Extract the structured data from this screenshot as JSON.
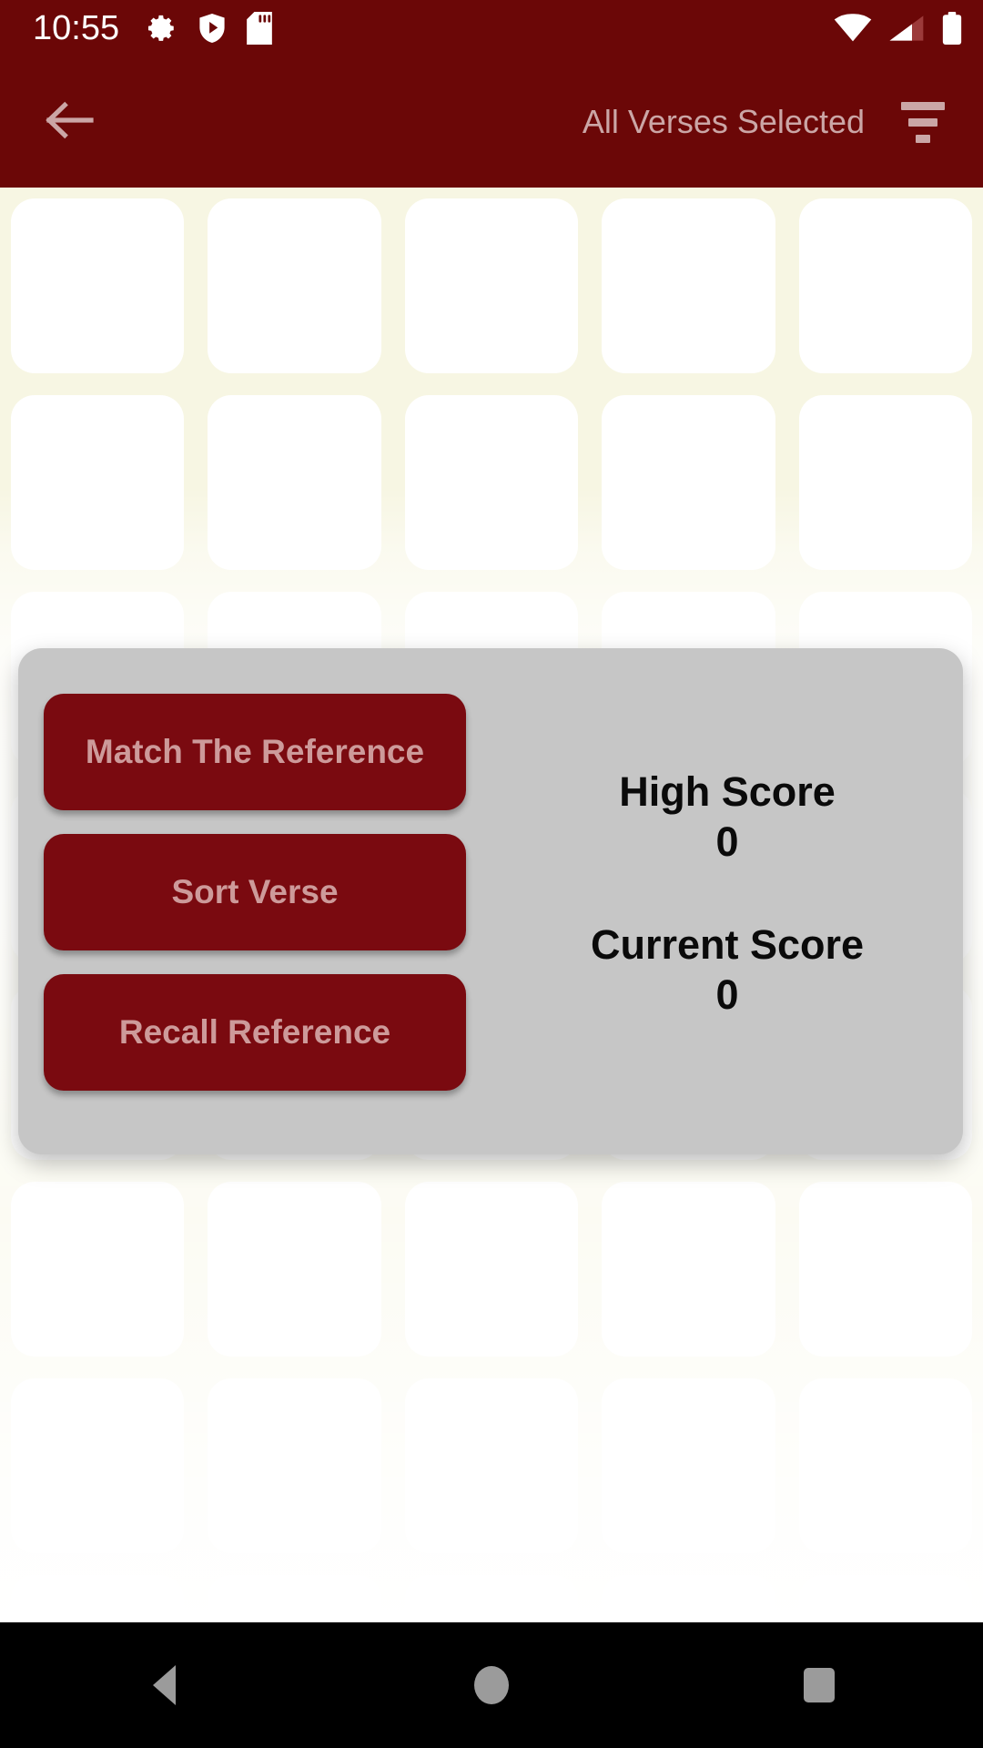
{
  "status_bar": {
    "clock": "10:55",
    "left_icons": [
      "gear-icon",
      "shield-play-icon",
      "sd-card-icon"
    ],
    "right_icons": [
      "wifi-icon",
      "cellular-signal-icon",
      "battery-icon"
    ],
    "background_color": "#6b0707",
    "text_color": "#ffffff"
  },
  "app_bar": {
    "back_icon": "arrow-left-icon",
    "title": "All Verses Selected",
    "filter_icon": "filter-icon",
    "background_color": "#6b0707",
    "title_color": "#cba6a6"
  },
  "background": {
    "surface_color": "#f7f6e3",
    "card_color": "#ffffff",
    "columns": 5,
    "rows": 8,
    "card_count": 40
  },
  "dialog": {
    "background_color": "#c6c6c6",
    "buttons": [
      {
        "label": "Match The Reference",
        "name": "match-the-reference-button"
      },
      {
        "label": "Sort Verse",
        "name": "sort-verse-button"
      },
      {
        "label": "Recall Reference",
        "name": "recall-reference-button"
      }
    ],
    "button_color": "#7a0a10",
    "button_text_color": "#cd9a9a",
    "scores": {
      "high_score_label": "High Score",
      "high_score_value": "0",
      "current_score_label": "Current Score",
      "current_score_value": "0",
      "text_color": "#0a0a0a"
    }
  },
  "nav_bar": {
    "background_color": "#000000",
    "icon_color": "#9b9b9b",
    "items": [
      {
        "name": "nav-back-button",
        "icon": "triangle-back-icon"
      },
      {
        "name": "nav-home-button",
        "icon": "circle-home-icon"
      },
      {
        "name": "nav-recents-button",
        "icon": "square-recents-icon"
      }
    ]
  }
}
